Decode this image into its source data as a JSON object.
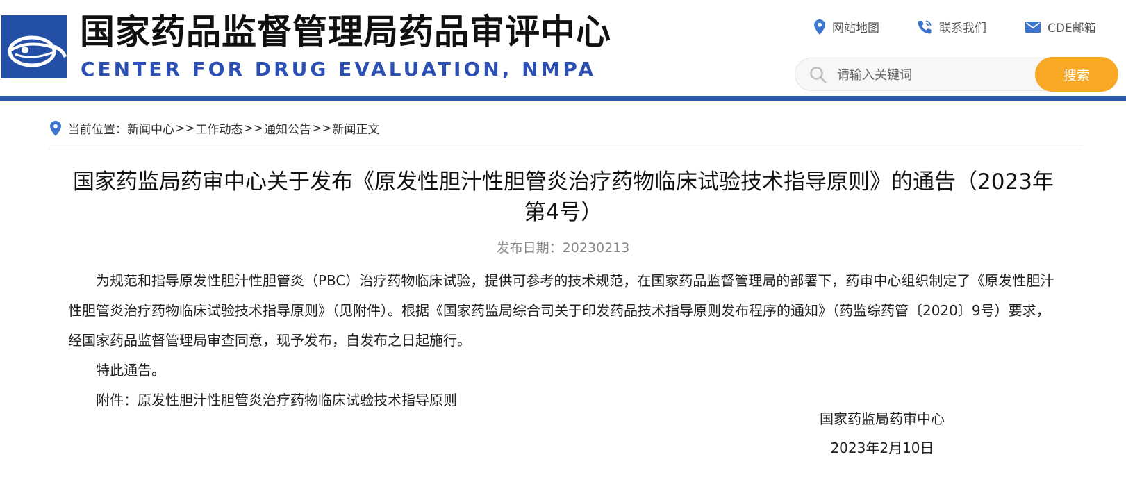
{
  "header": {
    "title": "国家药品监督管理局药品审评中心",
    "subtitle": "CENTER FOR DRUG EVALUATION, NMPA",
    "links": [
      {
        "label": "网站地图",
        "icon": "location-pin-icon"
      },
      {
        "label": "联系我们",
        "icon": "phone-icon"
      },
      {
        "label": "CDE邮箱",
        "icon": "mail-icon"
      }
    ],
    "search": {
      "placeholder": "请输入关键词",
      "value": "",
      "button_label": "搜索"
    }
  },
  "breadcrumb": {
    "prefix": "当前位置：",
    "items": [
      "新闻中心",
      "工作动态",
      "通知公告",
      "新闻正文"
    ],
    "separator": ">>"
  },
  "article": {
    "title": "国家药监局药审中心关于发布《原发性胆汁性胆管炎治疗药物临床试验技术指导原则》的通告（2023年第4号）",
    "date_label": "发布日期：",
    "date": "20230213",
    "paragraphs": [
      "为规范和指导原发性胆汁性胆管炎（PBC）治疗药物临床试验，提供可参考的技术规范，在国家药品监督管理局的部署下，药审中心组织制定了《原发性胆汁性胆管炎治疗药物临床试验技术指导原则》（见附件）。根据《国家药监局综合司关于印发药品技术指导原则发布程序的通知》（药监综药管〔2020〕9号）要求，经国家药品监督管理局审查同意，现予发布，自发布之日起施行。",
      "特此通告。",
      "附件：原发性胆汁性胆管炎治疗药物临床试验技术指导原则"
    ],
    "signature_org": "国家药监局药审中心",
    "signature_date": "2023年2月10日"
  },
  "colors": {
    "brand_blue": "#2b5bad",
    "subtitle_blue": "#2c4fb4",
    "search_button": "#f9a825",
    "icon_blue": "#3a76d0"
  }
}
